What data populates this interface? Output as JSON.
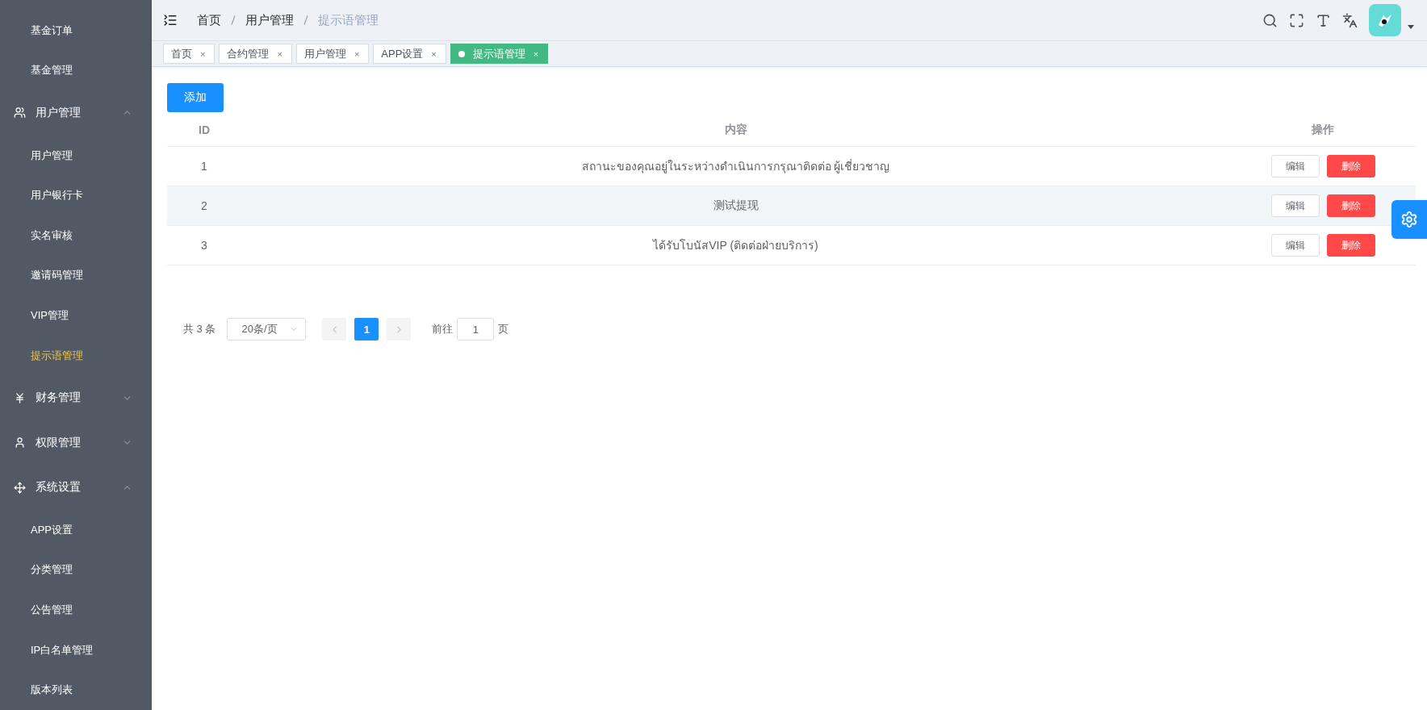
{
  "sidebar": {
    "items": [
      {
        "kind": "item",
        "label": "基金订单",
        "selected": false
      },
      {
        "kind": "item",
        "label": "基金管理",
        "selected": false
      },
      {
        "kind": "group",
        "label": "用户管理",
        "expanded": true,
        "children": [
          {
            "label": "用户管理",
            "selected": false
          },
          {
            "label": "用户银行卡",
            "selected": false
          },
          {
            "label": "实名审核",
            "selected": false
          },
          {
            "label": "邀请码管理",
            "selected": false
          },
          {
            "label": "VIP管理",
            "selected": false
          },
          {
            "label": "提示语管理",
            "selected": true
          }
        ]
      },
      {
        "kind": "group",
        "label": "财务管理",
        "expanded": false
      },
      {
        "kind": "group",
        "label": "权限管理",
        "expanded": false
      },
      {
        "kind": "group",
        "label": "系统设置",
        "expanded": true,
        "children": [
          {
            "label": "APP设置",
            "selected": false
          },
          {
            "label": "分类管理",
            "selected": false
          },
          {
            "label": "公告管理",
            "selected": false
          },
          {
            "label": "IP白名单管理",
            "selected": false
          },
          {
            "label": "版本列表",
            "selected": false
          }
        ]
      }
    ]
  },
  "breadcrumb": [
    "首页",
    "用户管理",
    "提示语管理"
  ],
  "tabs": [
    {
      "label": "首页",
      "close": "×",
      "selected": false
    },
    {
      "label": "合约管理",
      "close": "×",
      "selected": false
    },
    {
      "label": "用户管理",
      "close": "×",
      "selected": false
    },
    {
      "label": "APP设置",
      "close": "×",
      "selected": false
    },
    {
      "label": "提示语管理",
      "close": "×",
      "selected": true
    }
  ],
  "add_button": "添加",
  "table": {
    "columns": [
      "ID",
      "内容",
      "操作"
    ],
    "rows": [
      {
        "id": "1",
        "content": "สถานะของคุณอยู่ในระหว่างดำเนินการกรุณาติดต่อ ผู้เชี่ยวชาญ",
        "edit": "编辑",
        "delete": "删除",
        "highlighted": false
      },
      {
        "id": "2",
        "content": "测试提现",
        "edit": "编辑",
        "delete": "删除",
        "highlighted": true
      },
      {
        "id": "3",
        "content": "ได้รับโบนัสVIP (ติดต่อฝ่ายบริการ)",
        "edit": "编辑",
        "delete": "删除",
        "highlighted": false
      }
    ]
  },
  "pagination": {
    "total": "共 3 条",
    "page_size": "20条/页",
    "pages": [
      {
        "label": "1",
        "selected": true
      }
    ],
    "goto_label": "前往",
    "goto_value": "1",
    "goto_suffix": "页"
  }
}
